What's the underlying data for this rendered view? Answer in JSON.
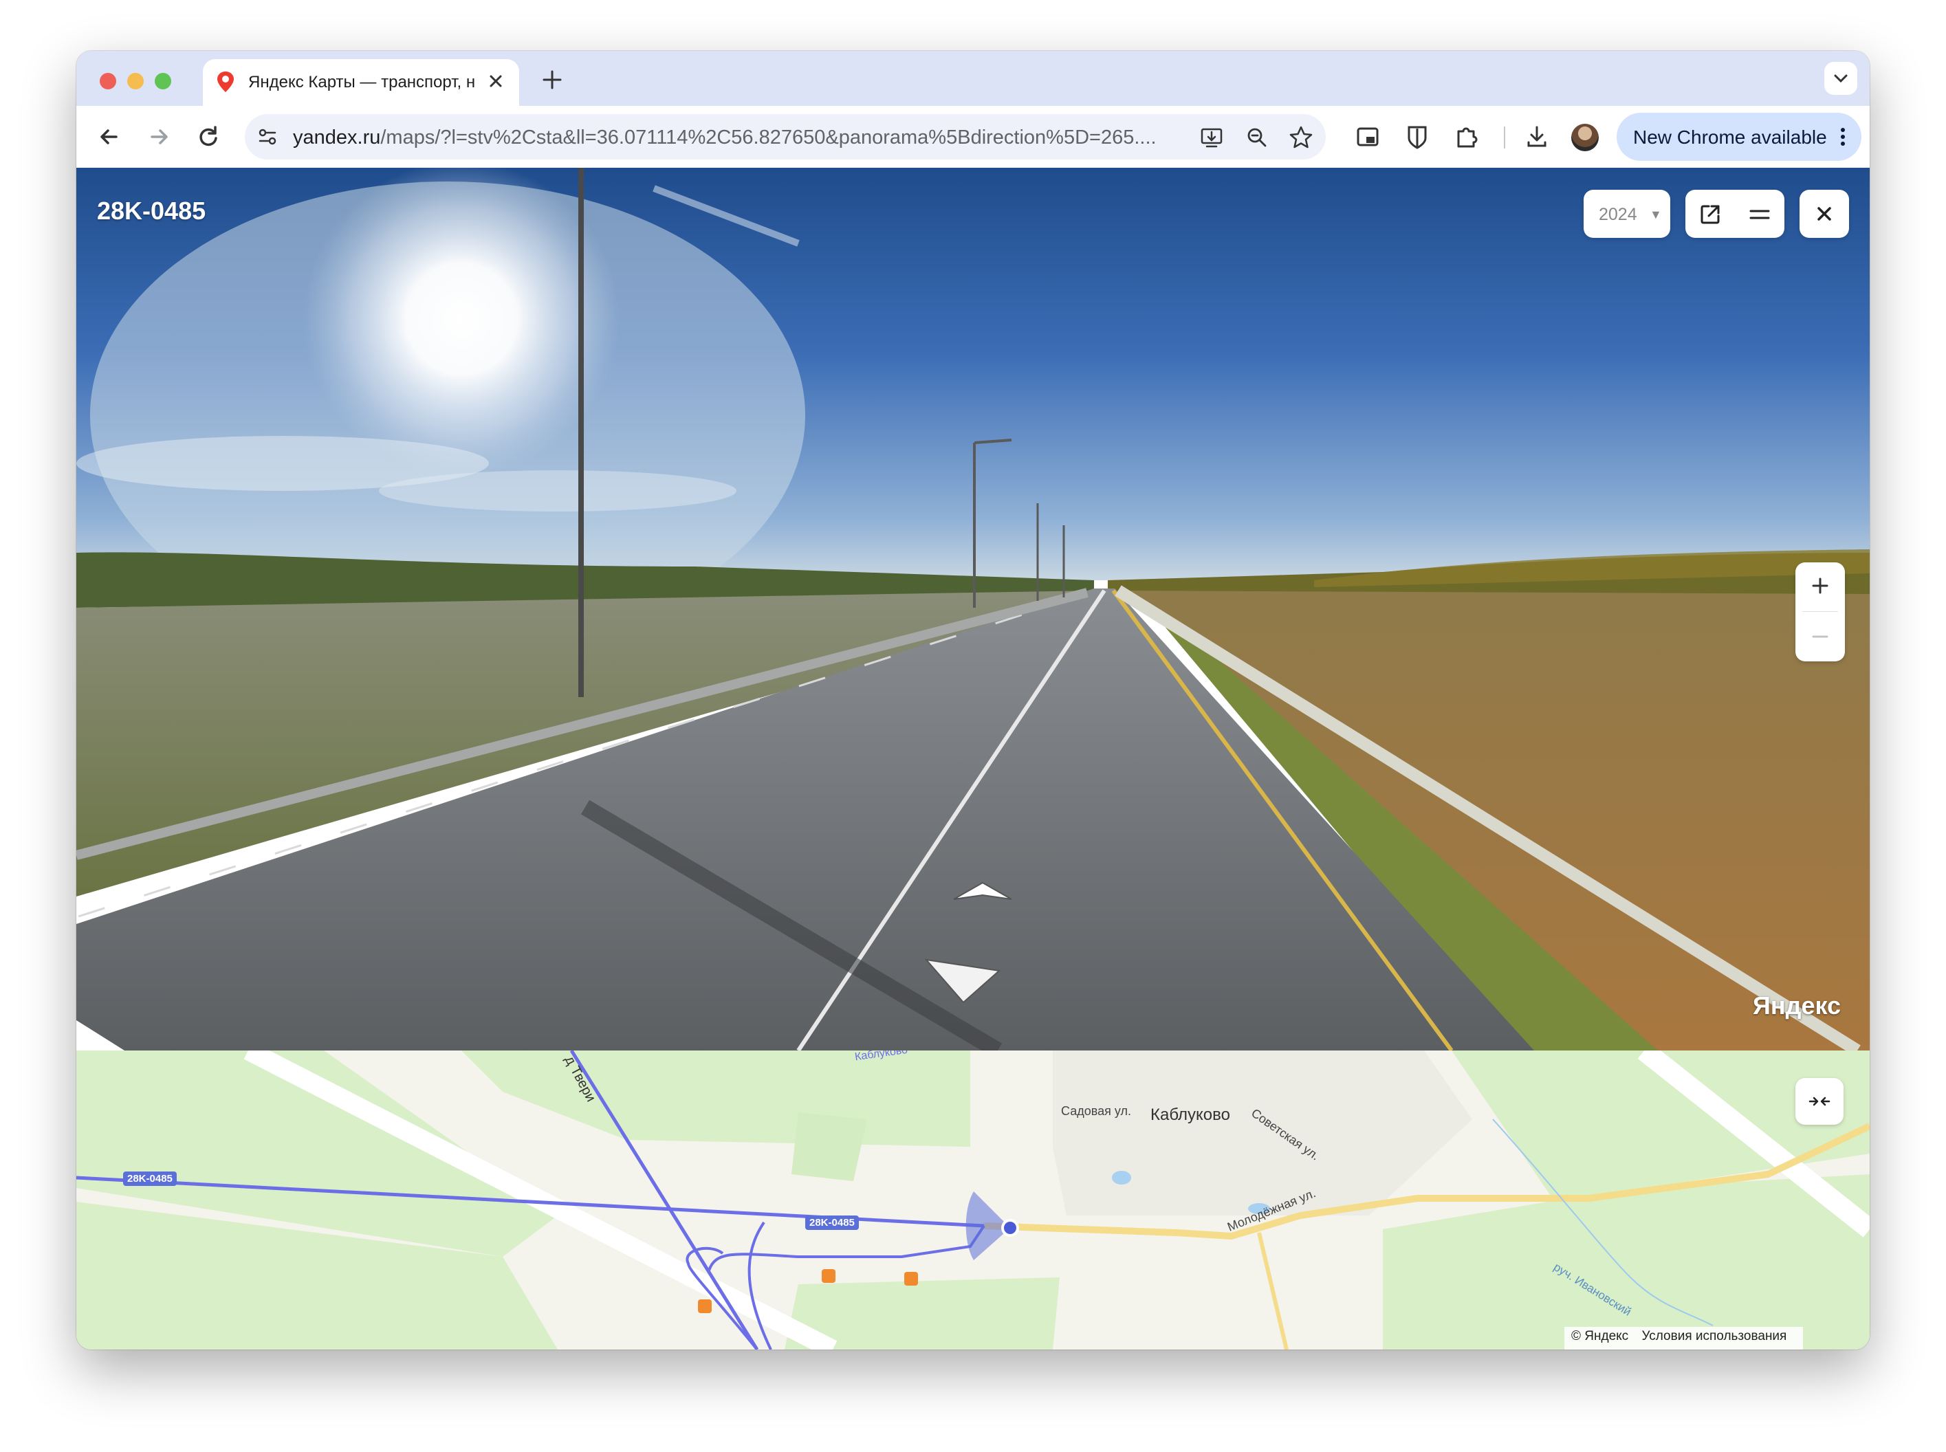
{
  "browser": {
    "tab_title": "Яндекс Карты — транспорт, навигация, поиск мест",
    "url_host": "yandex.ru",
    "url_path": "/maps/?l=stv%2Csta&ll=36.071114%2C56.827650&panorama%5Bdirection%5D=265....",
    "new_chrome_label": "New Chrome available"
  },
  "panorama": {
    "title": "28K-0485",
    "year": "2024",
    "watermark": "Яндекс"
  },
  "map": {
    "road_badge_left": "28K-0485",
    "road_badge_center": "28K-0485",
    "village": "Каблуково",
    "street_sadovaya": "Садовая ул.",
    "street_sovetskaya": "Советская ул.",
    "street_molodezhnaya": "Молодёжная ул.",
    "stream": "руч. Ивановский",
    "road_tver": "д Твери",
    "road_top": "Каблуково",
    "copyright": "© Яндекс",
    "terms": "Условия использования"
  },
  "colors": {
    "tabstrip": "#dde3f6",
    "accent_route": "#5b6fd8",
    "map_green": "#d9efc8"
  }
}
